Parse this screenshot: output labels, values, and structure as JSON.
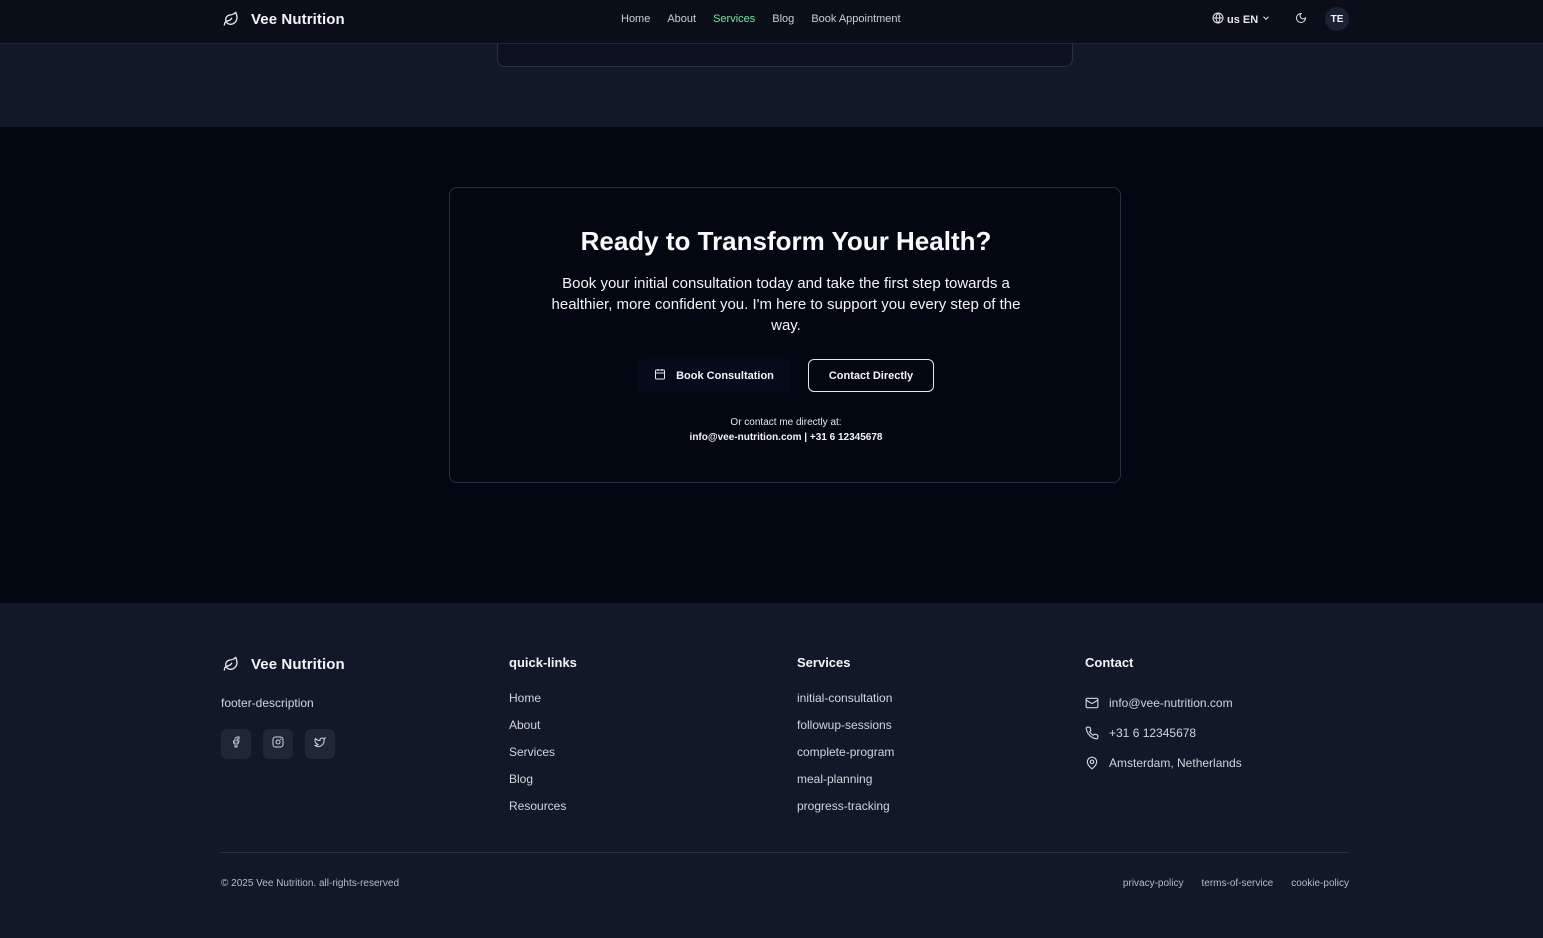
{
  "header": {
    "brand": "Vee Nutrition",
    "nav": [
      {
        "label": "Home",
        "active": false
      },
      {
        "label": "About",
        "active": false
      },
      {
        "label": "Services",
        "active": true
      },
      {
        "label": "Blog",
        "active": false
      },
      {
        "label": "Book Appointment",
        "active": false
      }
    ],
    "language": "us EN",
    "avatar_initials": "TE"
  },
  "cta": {
    "title": "Ready to Transform Your Health?",
    "text": "Book your initial consultation today and take the first step towards a healthier, more confident you. I'm here to support you every step of the way.",
    "book_label": "Book Consultation",
    "contact_label": "Contact Directly",
    "or_text": "Or contact me directly at:",
    "contact_details": "info@vee-nutrition.com | +31 6 12345678"
  },
  "footer": {
    "brand": "Vee Nutrition",
    "description": "footer-description",
    "socials": [
      "facebook-icon",
      "instagram-icon",
      "twitter-icon"
    ],
    "quick_links": {
      "title": "quick-links",
      "items": [
        "Home",
        "About",
        "Services",
        "Blog",
        "Resources"
      ]
    },
    "services": {
      "title": "Services",
      "items": [
        "initial-consultation",
        "followup-sessions",
        "complete-program",
        "meal-planning",
        "progress-tracking"
      ]
    },
    "contact": {
      "title": "Contact",
      "email": "info@vee-nutrition.com",
      "phone": "+31 6 12345678",
      "location": "Amsterdam, Netherlands"
    },
    "copyright": "© 2025 Vee Nutrition. all-rights-reserved",
    "legal": [
      "privacy-policy",
      "terms-of-service",
      "cookie-policy"
    ]
  },
  "colors": {
    "accent": "#6ee7a0",
    "page_bg": "#111827",
    "cta_bg": "#030712"
  }
}
